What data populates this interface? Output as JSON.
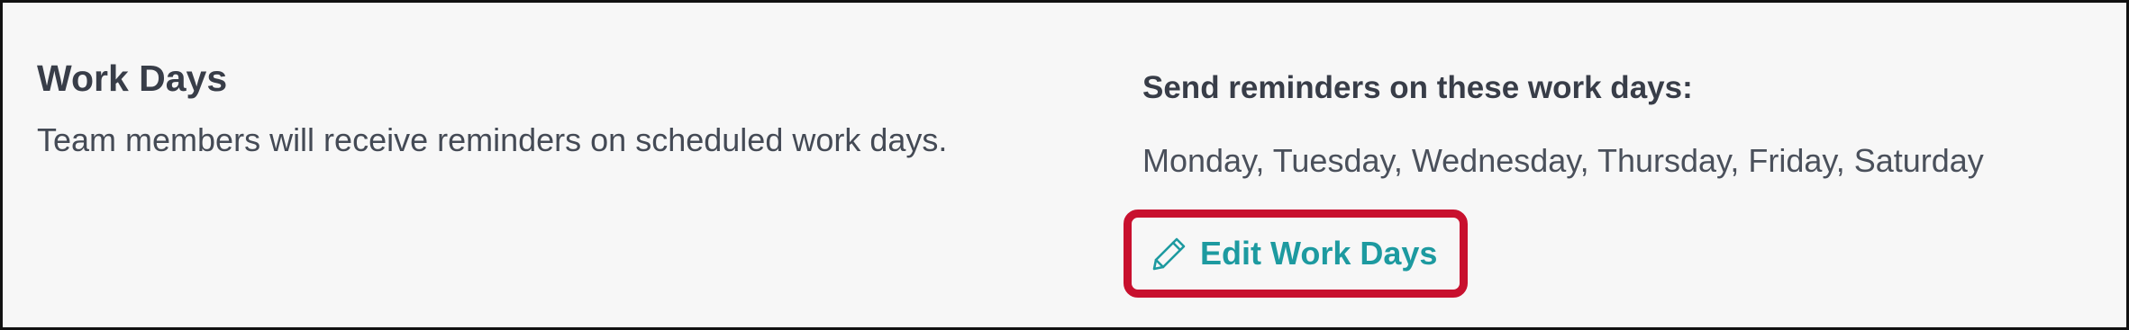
{
  "work_days": {
    "title": "Work Days",
    "description": "Team members will receive reminders on scheduled work days.",
    "reminder_heading": "Send reminders on these work days:",
    "days_list": "Monday, Tuesday, Wednesday, Thursday, Friday, Saturday",
    "edit_button_label": "Edit Work Days",
    "edit_icon": "pencil-icon"
  },
  "colors": {
    "accent": "#1d9aa0",
    "highlight_border": "#c8102e",
    "panel_background": "#f7f7f7",
    "text": "#3a3f4a"
  }
}
